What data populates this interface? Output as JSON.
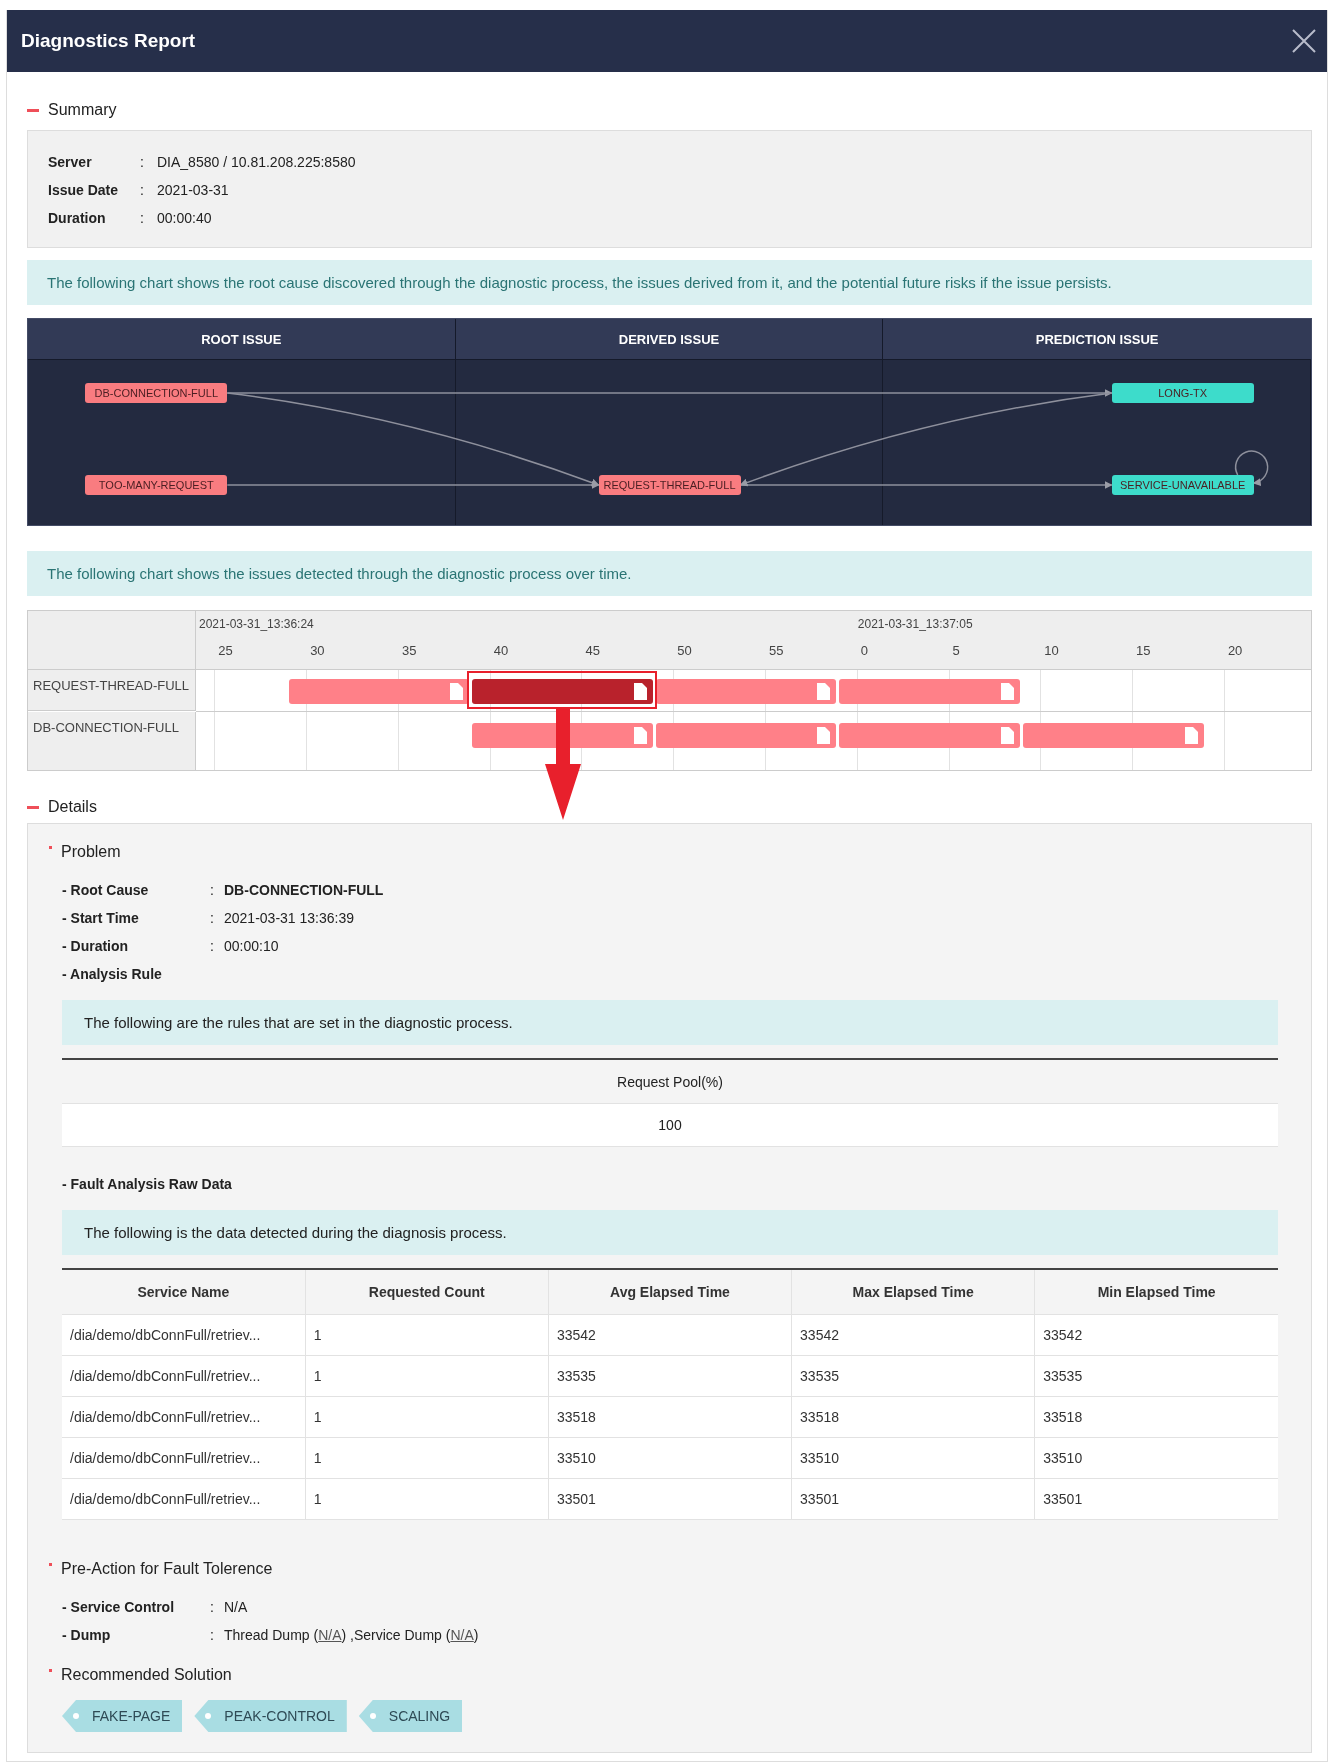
{
  "window": {
    "title": "Diagnostics Report"
  },
  "summary": {
    "title": "Summary",
    "fields": [
      {
        "label": "Server",
        "separator": ":",
        "value": "DIA_8580 / 10.81.208.225:8580"
      },
      {
        "label": "Issue Date",
        "separator": ":",
        "value": "2021-03-31"
      },
      {
        "label": "Duration",
        "separator": ":",
        "value": "00:00:40"
      }
    ]
  },
  "issue_graph": {
    "note": "The following chart shows the root cause discovered through the diagnostic process, the issues derived from it, and the potential future risks if the issue persists.",
    "columns": [
      {
        "title": "ROOT ISSUE",
        "nodes": [
          {
            "label": "DB-CONNECTION-FULL",
            "kind": "upper",
            "color": "#f97c80",
            "arrows": [
              {
                "kind": "across"
              },
              {
                "kind": "down"
              }
            ]
          },
          {
            "label": "TOO-MANY-REQUEST",
            "kind": "lower",
            "color": "#f97c80",
            "arrows": [
              {
                "kind": "across"
              }
            ]
          }
        ]
      },
      {
        "title": "DERIVED ISSUE",
        "nodes": [
          {
            "label": "REQUEST-THREAD-FULL",
            "kind": "lower",
            "color": "#f97c80",
            "arrows": [
              {
                "kind": "across"
              }
            ]
          }
        ]
      },
      {
        "title": "PREDICTION ISSUE",
        "nodes": [
          {
            "label": "LONG-TX",
            "kind": "upper",
            "color": "#3ddccb",
            "arrows": [
              {
                "kind": "back"
              }
            ]
          },
          {
            "label": "SERVICE-UNAVAILABLE",
            "kind": "lower",
            "color": "#3ddccb",
            "arrows": [
              {
                "kind": "loop"
              }
            ]
          }
        ]
      }
    ]
  },
  "timeline": {
    "note": "The following chart shows the issues detected through the diagnostic process over time.",
    "start_label": "2021-03-31_13:36:24",
    "ticks": [
      {
        "label": "25"
      },
      {
        "label": "30"
      },
      {
        "label": "35"
      },
      {
        "label": "40"
      },
      {
        "label": "45"
      },
      {
        "label": "50"
      },
      {
        "label": "55"
      },
      {
        "label": "0",
        "date": "2021-03-31_13:37:05"
      },
      {
        "label": "5"
      },
      {
        "label": "10"
      },
      {
        "label": "15"
      },
      {
        "label": "20"
      }
    ],
    "lanes": [
      {
        "label": "REQUEST-THREAD-FULL",
        "slots": [
          {
            "kind": "issue",
            "selected": false
          },
          {
            "kind": "issue",
            "selected": true
          },
          {
            "kind": "issue",
            "selected": false
          },
          {
            "kind": "issue",
            "selected": false
          }
        ]
      },
      {
        "label": "DB-CONNECTION-FULL",
        "slots": [
          {
            "kind": "gap"
          },
          {
            "kind": "issue",
            "selected": false
          },
          {
            "kind": "issue",
            "selected": false
          },
          {
            "kind": "issue",
            "selected": false
          },
          {
            "kind": "issue",
            "selected": false
          }
        ]
      }
    ]
  },
  "details": {
    "title": "Details",
    "problem": {
      "title": "Problem",
      "fields": [
        {
          "label": "- Root Cause",
          "separator": ":",
          "value": "DB-CONNECTION-FULL",
          "bold": true
        },
        {
          "label": "- Start Time",
          "separator": ":",
          "value": "2021-03-31 13:36:39",
          "bold": false
        },
        {
          "label": "- Duration",
          "separator": ":",
          "value": "00:00:10",
          "bold": false
        },
        {
          "label": "- Analysis Rule"
        }
      ],
      "rule_note": "The following are the rules that are set in the diagnostic process.",
      "rule_table": {
        "columns": [
          "Request Pool(%)"
        ],
        "rows": [
          [
            "100"
          ]
        ]
      },
      "raw_data_title": "- Fault Analysis Raw Data",
      "raw_data_note": "The following is the data detected during the diagnosis process.",
      "raw_data_table": {
        "columns": [
          "Service Name",
          "Requested Count",
          "Avg Elapsed Time",
          "Max Elapsed Time",
          "Min Elapsed Time"
        ],
        "rows": [
          [
            "/dia/demo/dbConnFull/retriev...",
            "1",
            "33542",
            "33542",
            "33542"
          ],
          [
            "/dia/demo/dbConnFull/retriev...",
            "1",
            "33535",
            "33535",
            "33535"
          ],
          [
            "/dia/demo/dbConnFull/retriev...",
            "1",
            "33518",
            "33518",
            "33518"
          ],
          [
            "/dia/demo/dbConnFull/retriev...",
            "1",
            "33510",
            "33510",
            "33510"
          ],
          [
            "/dia/demo/dbConnFull/retriev...",
            "1",
            "33501",
            "33501",
            "33501"
          ]
        ]
      }
    },
    "pre_action": {
      "title": "Pre-Action for Fault Tolerence",
      "fields": [
        {
          "label": "- Service Control",
          "separator": ":",
          "value": "N/A"
        },
        {
          "label": "- Dump",
          "separator": ":",
          "parts": [
            {
              "text": "Thread Dump ("
            },
            {
              "text": "N/A",
              "kind": "link"
            },
            {
              "text": ") ,Service Dump ("
            },
            {
              "text": "N/A",
              "kind": "link"
            },
            {
              "text": ")"
            }
          ]
        }
      ]
    },
    "recommended": {
      "title": "Recommended Solution",
      "tags": [
        "FAKE-PAGE",
        "PEAK-CONTROL",
        "SCALING"
      ]
    }
  }
}
